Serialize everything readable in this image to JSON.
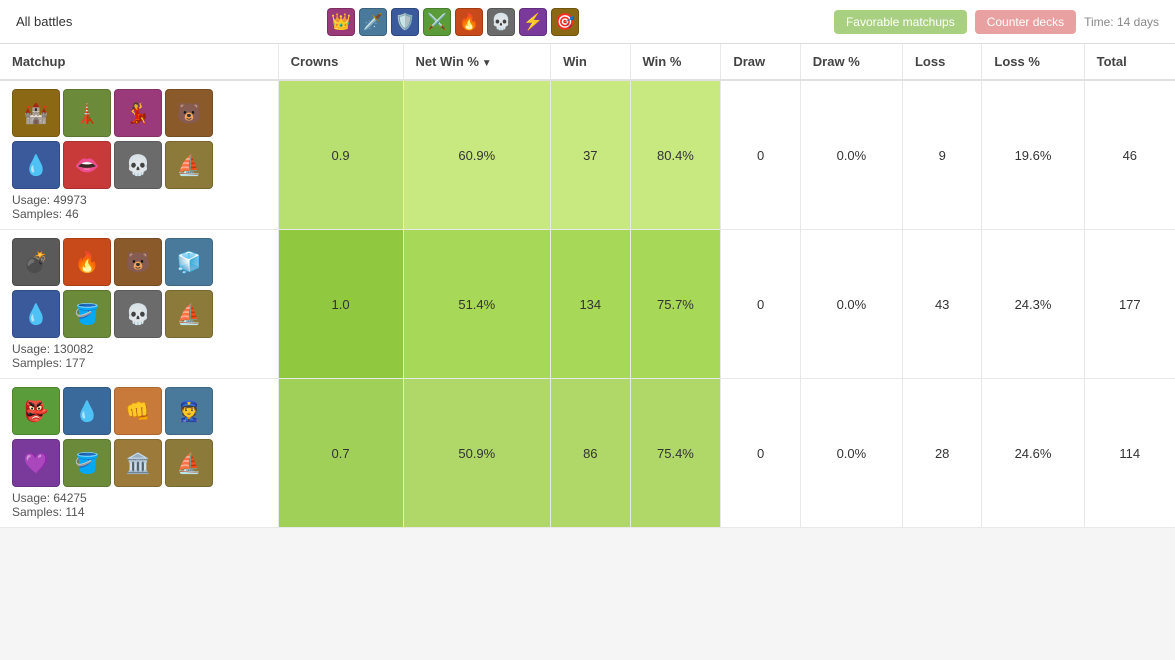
{
  "topbar": {
    "all_battles": "All battles",
    "favorable_matchups": "Favorable matchups",
    "counter_decks": "Counter decks",
    "time_label": "Time: 14 days"
  },
  "nav_icons": [
    "👑",
    "🗡️",
    "🛡️",
    "⚔️",
    "🔥",
    "💀",
    "⚡",
    "🎯"
  ],
  "columns": {
    "matchup": "Matchup",
    "crowns": "Crowns",
    "net_win_pct": "Net Win %",
    "win": "Win",
    "win_pct": "Win %",
    "draw": "Draw",
    "draw_pct": "Draw %",
    "loss": "Loss",
    "loss_pct": "Loss %",
    "total": "Total"
  },
  "rows": [
    {
      "usage": "Usage: 49973",
      "samples": "Samples: 46",
      "cards_row1": [
        "🏰",
        "🗼",
        "💃",
        "🐻"
      ],
      "cards_row2": [
        "💧",
        "👄",
        "💀",
        "⛵"
      ],
      "card_colors_row1": [
        "#8B6914",
        "#6B8B3A",
        "#9B3A7A",
        "#8B5A2B"
      ],
      "card_colors_row2": [
        "#3A5A9B",
        "#C83A3A",
        "#6B6B6B",
        "#8B7A3A"
      ],
      "crowns": "0.9",
      "net_win_pct": "60.9%",
      "win": "37",
      "win_pct": "80.4%",
      "draw": "0",
      "draw_pct": "0.0%",
      "loss": "9",
      "loss_pct": "19.6%",
      "total": "46"
    },
    {
      "usage": "Usage: 130082",
      "samples": "Samples: 177",
      "cards_row1": [
        "💣",
        "🔥",
        "🐻",
        "🧊"
      ],
      "cards_row2": [
        "💧",
        "🪣",
        "💀",
        "⛵"
      ],
      "card_colors_row1": [
        "#5A5A5A",
        "#C84A1A",
        "#8B5A2B",
        "#4A7A9B"
      ],
      "card_colors_row2": [
        "#3A5A9B",
        "#6B8B3A",
        "#6B6B6B",
        "#8B7A3A"
      ],
      "crowns": "1.0",
      "net_win_pct": "51.4%",
      "win": "134",
      "win_pct": "75.7%",
      "draw": "0",
      "draw_pct": "0.0%",
      "loss": "43",
      "loss_pct": "24.3%",
      "total": "177"
    },
    {
      "usage": "Usage: 64275",
      "samples": "Samples: 114",
      "cards_row1": [
        "👺",
        "💧",
        "👊",
        "👮"
      ],
      "cards_row2": [
        "💜",
        "🪣",
        "🏛️",
        "⛵"
      ],
      "card_colors_row1": [
        "#5A9B3A",
        "#3A6A9B",
        "#C87A3A",
        "#4A7A9B"
      ],
      "card_colors_row2": [
        "#7A3A9B",
        "#6B8B3A",
        "#9B7A3A",
        "#8B7A3A"
      ],
      "crowns": "0.7",
      "net_win_pct": "50.9%",
      "win": "86",
      "win_pct": "75.4%",
      "draw": "0",
      "draw_pct": "0.0%",
      "loss": "28",
      "loss_pct": "24.6%",
      "total": "114"
    }
  ]
}
